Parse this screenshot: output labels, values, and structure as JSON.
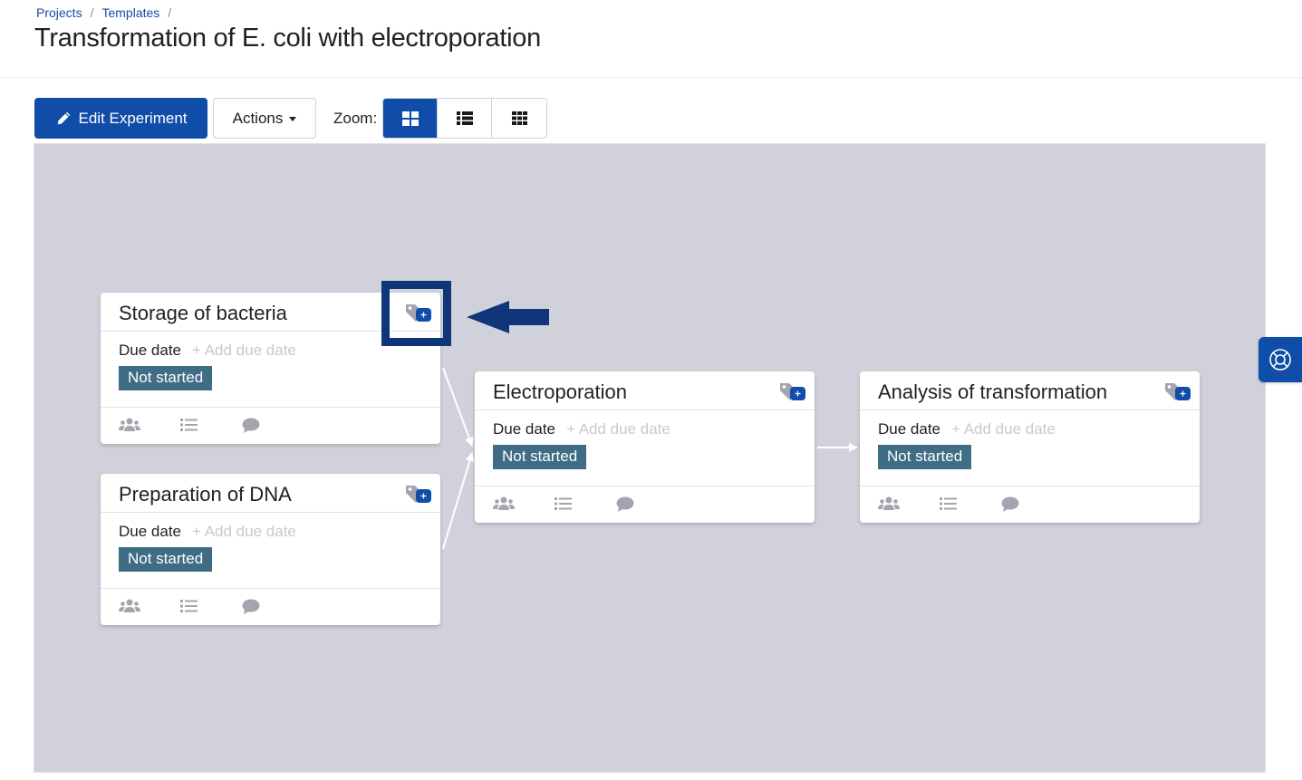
{
  "breadcrumb": [
    {
      "label": "Projects"
    },
    {
      "label": "Templates"
    }
  ],
  "breadcrumb_separator": "/",
  "page_title": "Transformation of E. coli with electroporation",
  "toolbar": {
    "edit_label": "Edit Experiment",
    "actions_label": "Actions",
    "zoom_label": "Zoom:",
    "zoom_options": [
      {
        "name": "large-cards",
        "icon": "th-large-icon",
        "active": true
      },
      {
        "name": "list",
        "icon": "th-list-icon",
        "active": false
      },
      {
        "name": "small-cards",
        "icon": "th-icon",
        "active": false
      }
    ]
  },
  "colors": {
    "primary": "#104da9",
    "status_not_started": "#406d86",
    "canvas_bg": "#d0d1da",
    "annotation": "#0f3679"
  },
  "tasks": [
    {
      "title": "Storage of bacteria",
      "due_label": "Due date",
      "due_add": "+ Add due date",
      "status": "Not started"
    },
    {
      "title": "Preparation of DNA",
      "due_label": "Due date",
      "due_add": "+ Add due date",
      "status": "Not started"
    },
    {
      "title": "Electroporation",
      "due_label": "Due date",
      "due_add": "+ Add due date",
      "status": "Not started"
    },
    {
      "title": "Analysis of transformation",
      "due_label": "Due date",
      "due_add": "+ Add due date",
      "status": "Not started"
    }
  ],
  "connections": [
    {
      "from": "Storage of bacteria",
      "to": "Electroporation"
    },
    {
      "from": "Preparation of DNA",
      "to": "Electroporation"
    },
    {
      "from": "Electroporation",
      "to": "Analysis of transformation"
    }
  ],
  "card_footer_icons": [
    "users-icon",
    "list-icon",
    "comment-icon"
  ],
  "annotation": {
    "highlighted": "tag-button on Storage of bacteria",
    "arrow_direction": "left"
  },
  "help_button": {
    "icon": "life-ring-icon"
  }
}
